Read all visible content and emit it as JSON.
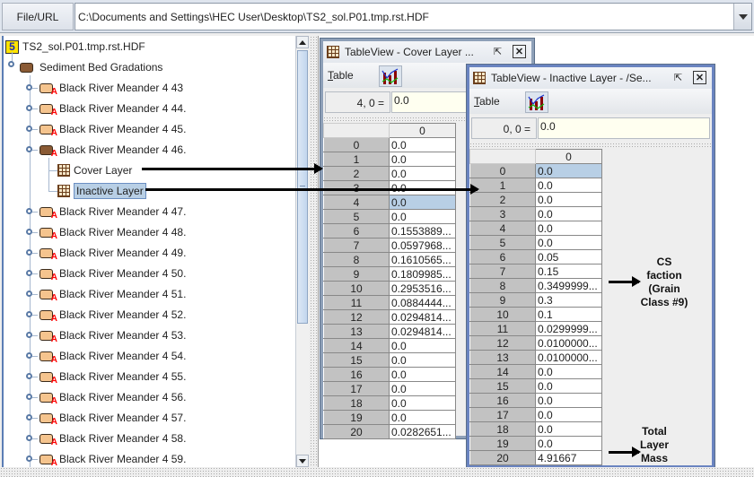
{
  "toolbar": {
    "file_url_label": "File/URL",
    "path_value": "C:\\Documents and Settings\\HEC User\\Desktop\\TS2_sol.P01.tmp.rst.HDF"
  },
  "tree": {
    "root_label": "TS2_sol.P01.tmp.rst.HDF",
    "group_label": "Sediment Bed Gradations",
    "items": [
      {
        "label": "Black River Meander 4 43"
      },
      {
        "label": "Black River Meander 4 44."
      },
      {
        "label": "Black River Meander 4 45."
      },
      {
        "label": "Black River Meander 4 46.",
        "expanded": true,
        "children": [
          {
            "label": "Cover Layer"
          },
          {
            "label": "Inactive Layer",
            "selected": true
          }
        ]
      },
      {
        "label": "Black River Meander 4 47."
      },
      {
        "label": "Black River Meander 4 48."
      },
      {
        "label": "Black River Meander 4 49."
      },
      {
        "label": "Black River Meander 4 50."
      },
      {
        "label": "Black River Meander 4 51."
      },
      {
        "label": "Black River Meander 4 52."
      },
      {
        "label": "Black River Meander 4 53."
      },
      {
        "label": "Black River Meander 4 54."
      },
      {
        "label": "Black River Meander 4 55."
      },
      {
        "label": "Black River Meander 4 56."
      },
      {
        "label": "Black River Meander 4 57."
      },
      {
        "label": "Black River Meander 4 58."
      },
      {
        "label": "Black River Meander 4 59."
      }
    ]
  },
  "cover_view": {
    "title": "TableView  -  Cover Layer  ...",
    "menu_table": "Table",
    "cell_ref": "4, 0  =",
    "cell_value": "0.0",
    "column_header": "0",
    "selected_row": 4,
    "rows": [
      "0.0",
      "0.0",
      "0.0",
      "0.0",
      "0.0",
      "0.0",
      "0.1553889...",
      "0.0597968...",
      "0.1610565...",
      "0.1809985...",
      "0.2953516...",
      "0.0884444...",
      "0.0294814...",
      "0.0294814...",
      "0.0",
      "0.0",
      "0.0",
      "0.0",
      "0.0",
      "0.0",
      "0.0282651..."
    ]
  },
  "inactive_view": {
    "title": "TableView  -  Inactive Layer  -  /Se...",
    "menu_table": "Table",
    "cell_ref": "0, 0  =",
    "cell_value": "0.0",
    "column_header": "0",
    "selected_row": 0,
    "rows": [
      "0.0",
      "0.0",
      "0.0",
      "0.0",
      "0.0",
      "0.0",
      "0.05",
      "0.15",
      "0.3499999...",
      "0.3",
      "0.1",
      "0.0299999...",
      "0.0100000...",
      "0.0100000...",
      "0.0",
      "0.0",
      "0.0",
      "0.0",
      "0.0",
      "0.0",
      "4.91667"
    ]
  },
  "annotations": {
    "cs_fraction": [
      "CS",
      "faction",
      "(Grain",
      "Class #9)"
    ],
    "total_mass": [
      "Total",
      "Layer",
      "Mass"
    ]
  }
}
